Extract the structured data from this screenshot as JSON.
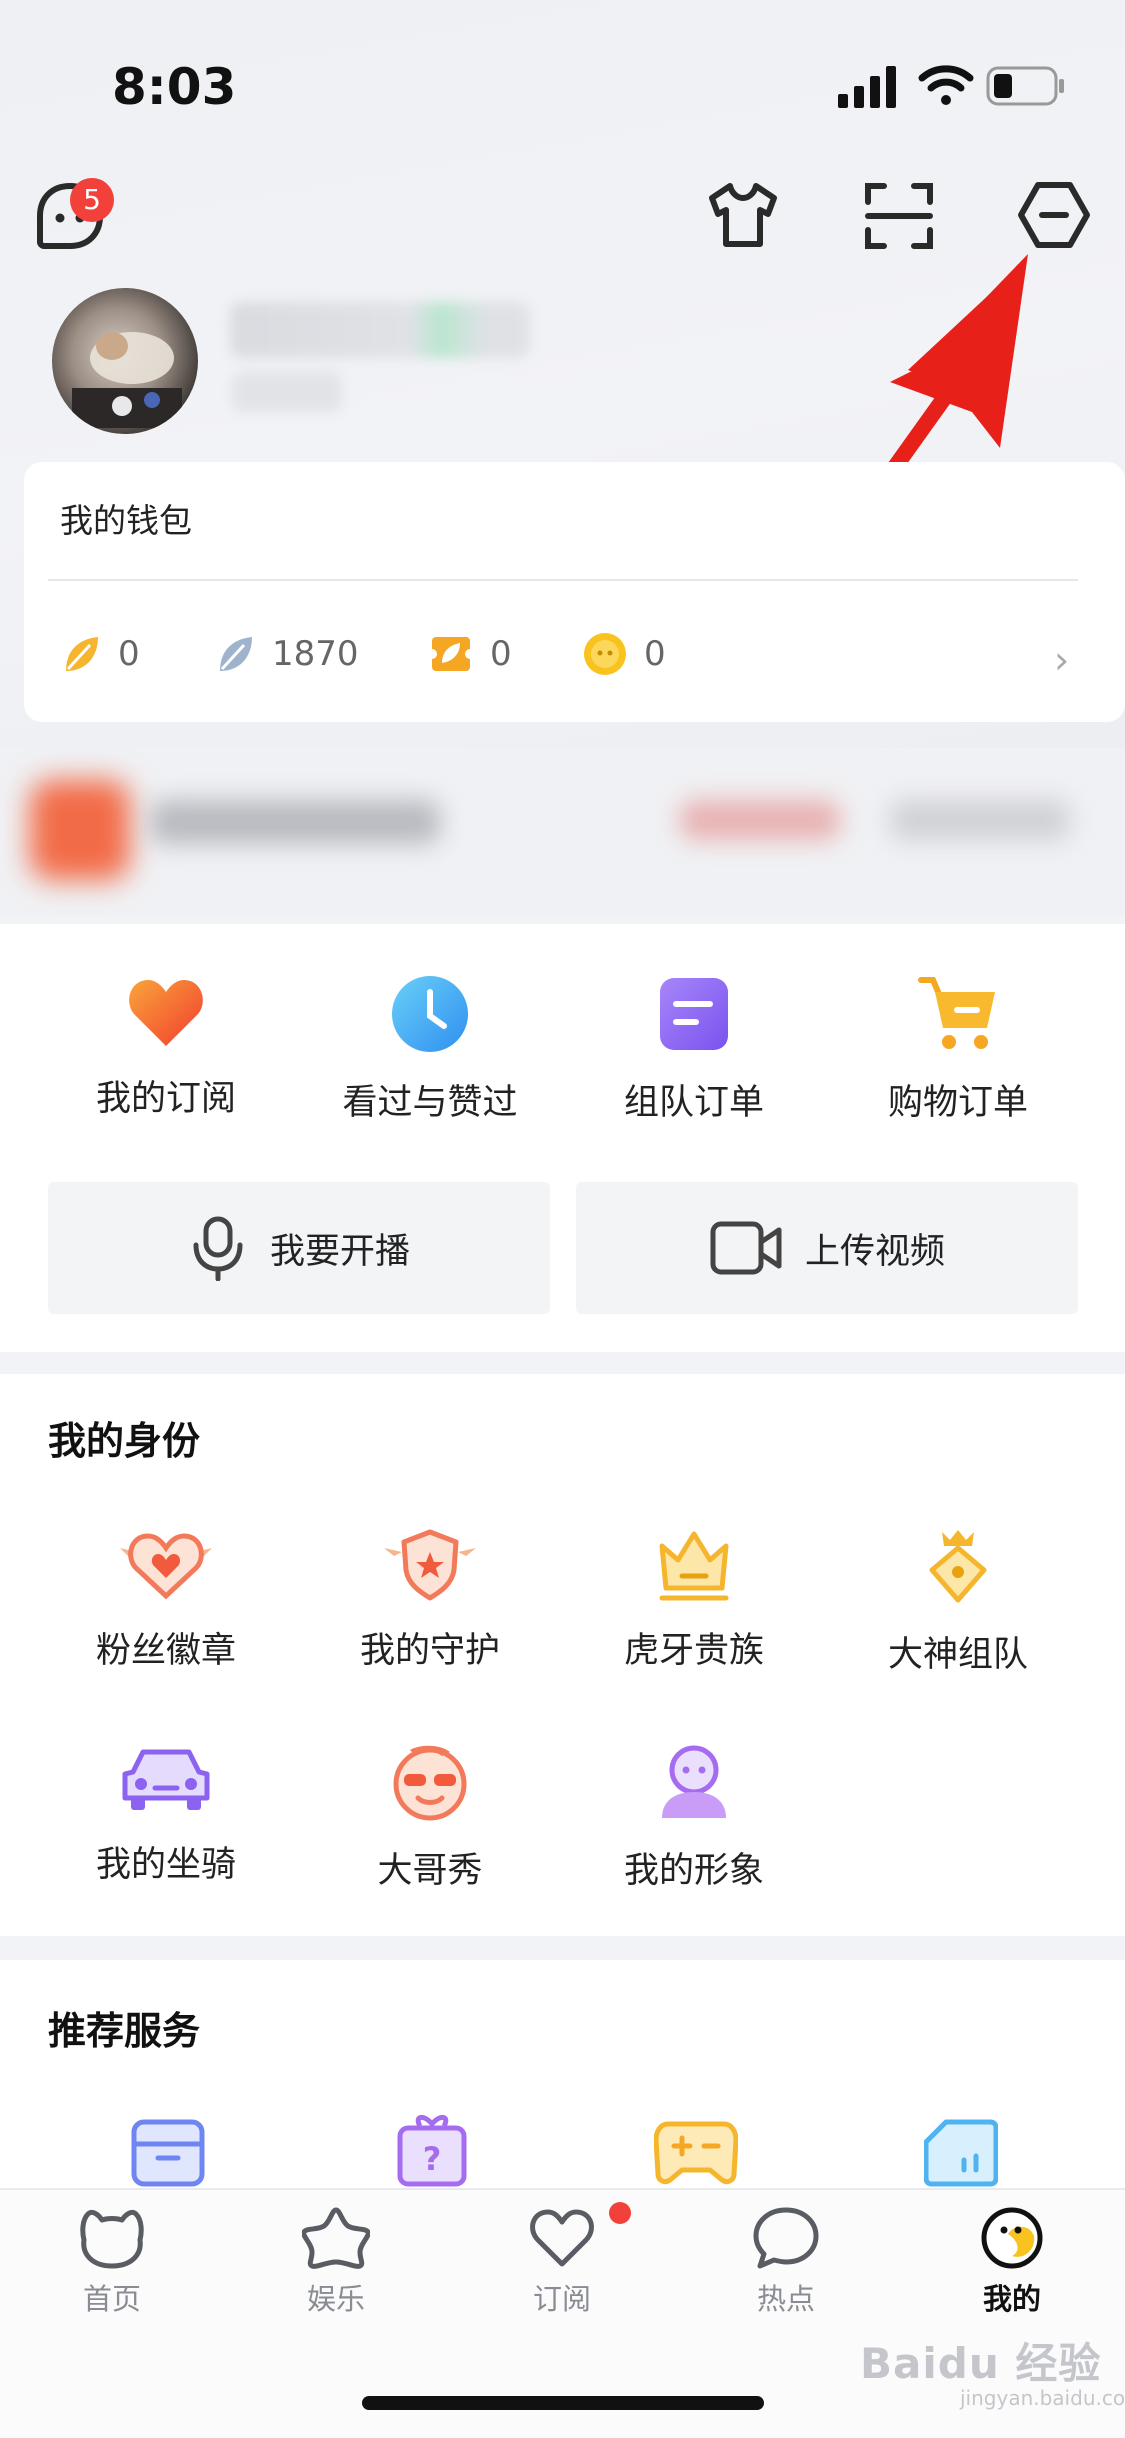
{
  "status_bar": {
    "time": "8:03"
  },
  "header": {
    "notification_count": "5"
  },
  "wallet": {
    "title": "我的钱包",
    "items": [
      {
        "icon": "gold-leaf-icon",
        "value": "0"
      },
      {
        "icon": "silver-leaf-icon",
        "value": "1870"
      },
      {
        "icon": "ticket-icon",
        "value": "0"
      },
      {
        "icon": "coin-icon",
        "value": "0"
      }
    ]
  },
  "quick": {
    "items": [
      {
        "label": "我的订阅",
        "icon": "heart-icon"
      },
      {
        "label": "看过与赞过",
        "icon": "clock-icon"
      },
      {
        "label": "组队订单",
        "icon": "document-icon"
      },
      {
        "label": "购物订单",
        "icon": "cart-icon"
      }
    ],
    "live_label": "我要开播",
    "upload_label": "上传视频"
  },
  "identity": {
    "title": "我的身份",
    "items": [
      {
        "label": "粉丝徽章",
        "icon": "heart-badge-icon"
      },
      {
        "label": "我的守护",
        "icon": "shield-icon"
      },
      {
        "label": "虎牙贵族",
        "icon": "crown-icon"
      },
      {
        "label": "大神组队",
        "icon": "crown-gem-icon"
      },
      {
        "label": "我的坐骑",
        "icon": "car-icon"
      },
      {
        "label": "大哥秀",
        "icon": "cool-face-icon"
      },
      {
        "label": "我的形象",
        "icon": "avatar-figure-icon"
      }
    ]
  },
  "services": {
    "title": "推荐服务",
    "icons": [
      "box-icon",
      "gift-icon",
      "gamepad-icon",
      "card-icon"
    ]
  },
  "tabs": [
    {
      "label": "首页",
      "icon": "home-icon"
    },
    {
      "label": "娱乐",
      "icon": "star-icon"
    },
    {
      "label": "订阅",
      "icon": "heart-outline-icon"
    },
    {
      "label": "热点",
      "icon": "chat-bubble-icon"
    },
    {
      "label": "我的",
      "icon": "smiley-icon",
      "active": true
    }
  ],
  "watermark": {
    "text": "Baidu 经验",
    "sub": "jingyan.baidu.com"
  },
  "colors": {
    "accent_red": "#f2403b",
    "arrow_red": "#e8201a",
    "tab_inactive": "#8a8c93"
  }
}
